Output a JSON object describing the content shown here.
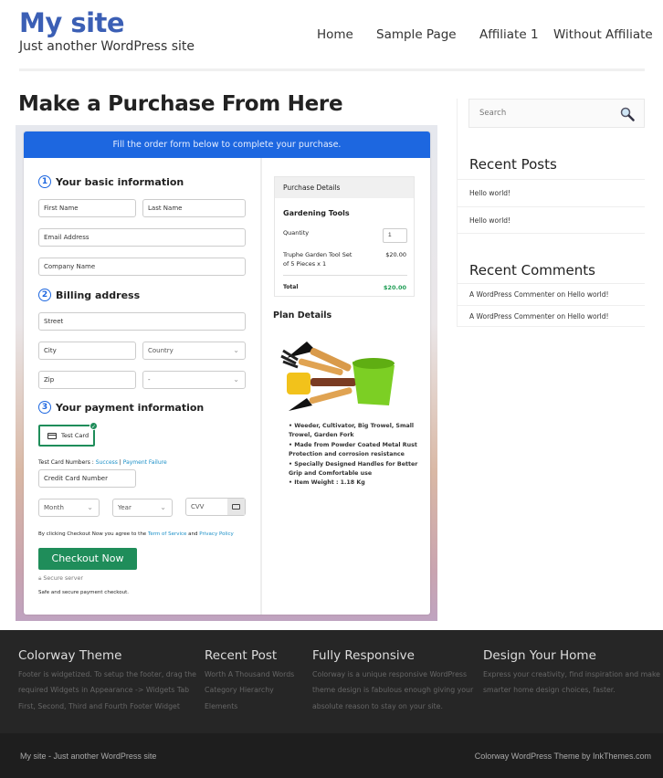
{
  "header": {
    "site_title": "My site",
    "tagline": "Just another WordPress site",
    "nav": [
      "Home",
      "Sample Page",
      "Affiliate 1",
      "Without Affiliate"
    ]
  },
  "main": {
    "page_title": "Make a Purchase From Here",
    "form": {
      "banner": "Fill the order form below to complete your purchase.",
      "section1": {
        "num": "1",
        "title": "Your basic information"
      },
      "first_name": "First Name",
      "last_name": "Last Name",
      "email": "Email Address",
      "company": "Company Name",
      "section2": {
        "num": "2",
        "title": "Billing address"
      },
      "street": "Street",
      "city": "City",
      "country": "Country",
      "zip": "Zip",
      "state": "-",
      "section3": {
        "num": "3",
        "title": "Your payment information"
      },
      "test_card": "Test Card",
      "test_numbers_label": "Test Card Numbers : ",
      "success_link": "Success",
      "separator": " | ",
      "failure_link": "Payment Failure",
      "card_number": "Credit Card Number",
      "month": "Month",
      "year": "Year",
      "cvv": "CVV",
      "agree_prefix": "By clicking Checkout Now you agree to the ",
      "terms_link": "Term of Service",
      "agree_and": " and ",
      "privacy_link": "Privacy Policy",
      "checkout_button": "Checkout Now",
      "secure_server": "Secure server",
      "safe_text": "Safe and secure payment checkout."
    },
    "purchase": {
      "header": "Purchase Details",
      "product": "Gardening Tools",
      "quantity_label": "Quantity",
      "quantity_value": "1",
      "item_line1": "Truphe Garden Tool Set",
      "item_line2": "of 5 Pieces x 1",
      "item_price": "$20.00",
      "total_label": "Total",
      "total_value": "$20.00",
      "total_color": "#1f9d55"
    },
    "plan": {
      "title": "Plan Details",
      "features": [
        "Weeder, Cultivator, Big Trowel, Small Trowel, Garden Fork",
        "Made from Powder Coated Metal Rust Protection and corrosion resistance",
        "Specially Designed Handles for Better Grip and Comfortable use",
        "Item Weight : 1.18 Kg"
      ]
    }
  },
  "sidebar": {
    "search_placeholder": "Search",
    "recent_posts_title": "Recent Posts",
    "recent_posts": [
      "Hello world!",
      "Hello world!"
    ],
    "recent_comments_title": "Recent Comments",
    "recent_comments": [
      "A WordPress Commenter on Hello world!",
      "A WordPress Commenter on Hello world!"
    ]
  },
  "footer": {
    "columns": [
      {
        "title": "Colorway Theme",
        "lines": [
          "Footer is widgetized. To setup the footer, drag the",
          "required Widgets in Appearance -> Widgets Tab",
          "First, Second, Third and Fourth Footer Widget"
        ]
      },
      {
        "title": "Recent Post",
        "lines": [
          "Worth A Thousand Words",
          "Category Hierarchy",
          "Elements"
        ]
      },
      {
        "title": "Fully Responsive",
        "lines": [
          "Colorway is a unique responsive WordPress",
          "theme design is fabulous enough giving your",
          "absolute reason to stay on your site."
        ]
      },
      {
        "title": "Design Your Home",
        "lines": [
          "Express your creativity, find inspiration and make",
          "smarter home design choices, faster."
        ]
      }
    ],
    "bottom_left": "My site - Just another WordPress site",
    "bottom_right": "Colorway WordPress Theme by InkThemes.com"
  },
  "colors": {
    "brand": "#3b5fb5",
    "banner": "#1d67e0",
    "checkout": "#1f8d5a"
  }
}
